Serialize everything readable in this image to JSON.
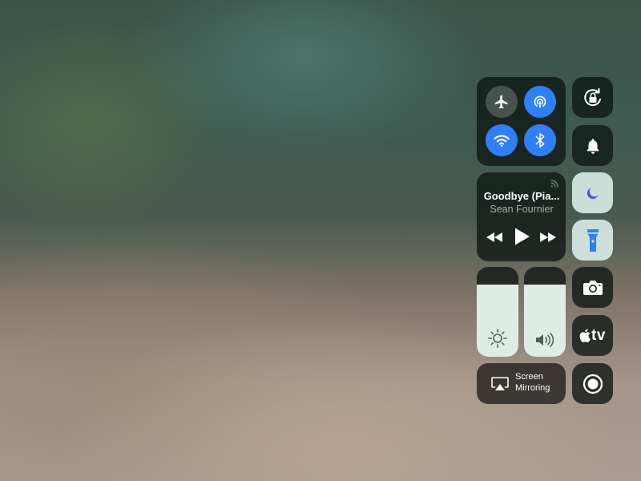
{
  "connectivity": {
    "airplane": {
      "icon": "airplane-icon",
      "active": false
    },
    "airdrop": {
      "icon": "airdrop-icon",
      "active": true
    },
    "wifi": {
      "icon": "wifi-icon",
      "active": true
    },
    "bluetooth": {
      "icon": "bluetooth-icon",
      "active": true
    }
  },
  "now_playing": {
    "title": "Goodbye (Pia...",
    "artist": "Sean Fournier",
    "controls": [
      "rewind-icon",
      "play-icon",
      "fast-forward-icon"
    ]
  },
  "sliders": {
    "brightness": {
      "icon": "brightness-icon",
      "level": 0.8
    },
    "volume": {
      "icon": "volume-icon",
      "level": 0.8
    }
  },
  "screen_mirroring": {
    "line1": "Screen",
    "line2": "Mirroring"
  },
  "apple_tv": {
    "label": "tv"
  },
  "colors": {
    "accent_blue": "#2f7ff6",
    "moon": "#5b4ee0",
    "flashlight": "#2f7ff6"
  }
}
